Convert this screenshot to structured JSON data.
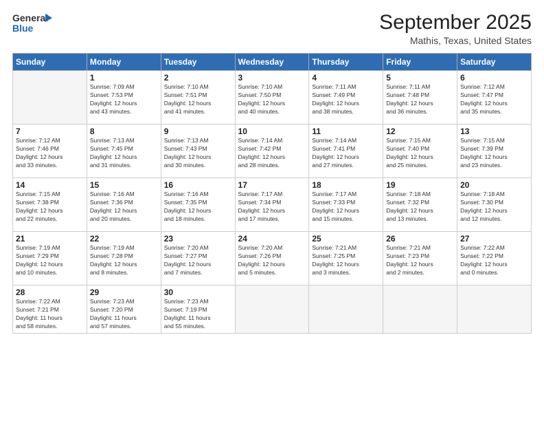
{
  "logo": {
    "line1": "General",
    "line2": "Blue"
  },
  "header": {
    "month": "September 2025",
    "location": "Mathis, Texas, United States"
  },
  "weekdays": [
    "Sunday",
    "Monday",
    "Tuesday",
    "Wednesday",
    "Thursday",
    "Friday",
    "Saturday"
  ],
  "weeks": [
    [
      {
        "day": "",
        "info": ""
      },
      {
        "day": "1",
        "info": "Sunrise: 7:09 AM\nSunset: 7:53 PM\nDaylight: 12 hours\nand 43 minutes."
      },
      {
        "day": "2",
        "info": "Sunrise: 7:10 AM\nSunset: 7:51 PM\nDaylight: 12 hours\nand 41 minutes."
      },
      {
        "day": "3",
        "info": "Sunrise: 7:10 AM\nSunset: 7:50 PM\nDaylight: 12 hours\nand 40 minutes."
      },
      {
        "day": "4",
        "info": "Sunrise: 7:11 AM\nSunset: 7:49 PM\nDaylight: 12 hours\nand 38 minutes."
      },
      {
        "day": "5",
        "info": "Sunrise: 7:11 AM\nSunset: 7:48 PM\nDaylight: 12 hours\nand 36 minutes."
      },
      {
        "day": "6",
        "info": "Sunrise: 7:12 AM\nSunset: 7:47 PM\nDaylight: 12 hours\nand 35 minutes."
      }
    ],
    [
      {
        "day": "7",
        "info": "Sunrise: 7:12 AM\nSunset: 7:46 PM\nDaylight: 12 hours\nand 33 minutes."
      },
      {
        "day": "8",
        "info": "Sunrise: 7:13 AM\nSunset: 7:45 PM\nDaylight: 12 hours\nand 31 minutes."
      },
      {
        "day": "9",
        "info": "Sunrise: 7:13 AM\nSunset: 7:43 PM\nDaylight: 12 hours\nand 30 minutes."
      },
      {
        "day": "10",
        "info": "Sunrise: 7:14 AM\nSunset: 7:42 PM\nDaylight: 12 hours\nand 28 minutes."
      },
      {
        "day": "11",
        "info": "Sunrise: 7:14 AM\nSunset: 7:41 PM\nDaylight: 12 hours\nand 27 minutes."
      },
      {
        "day": "12",
        "info": "Sunrise: 7:15 AM\nSunset: 7:40 PM\nDaylight: 12 hours\nand 25 minutes."
      },
      {
        "day": "13",
        "info": "Sunrise: 7:15 AM\nSunset: 7:39 PM\nDaylight: 12 hours\nand 23 minutes."
      }
    ],
    [
      {
        "day": "14",
        "info": "Sunrise: 7:15 AM\nSunset: 7:38 PM\nDaylight: 12 hours\nand 22 minutes."
      },
      {
        "day": "15",
        "info": "Sunrise: 7:16 AM\nSunset: 7:36 PM\nDaylight: 12 hours\nand 20 minutes."
      },
      {
        "day": "16",
        "info": "Sunrise: 7:16 AM\nSunset: 7:35 PM\nDaylight: 12 hours\nand 18 minutes."
      },
      {
        "day": "17",
        "info": "Sunrise: 7:17 AM\nSunset: 7:34 PM\nDaylight: 12 hours\nand 17 minutes."
      },
      {
        "day": "18",
        "info": "Sunrise: 7:17 AM\nSunset: 7:33 PM\nDaylight: 12 hours\nand 15 minutes."
      },
      {
        "day": "19",
        "info": "Sunrise: 7:18 AM\nSunset: 7:32 PM\nDaylight: 12 hours\nand 13 minutes."
      },
      {
        "day": "20",
        "info": "Sunrise: 7:18 AM\nSunset: 7:30 PM\nDaylight: 12 hours\nand 12 minutes."
      }
    ],
    [
      {
        "day": "21",
        "info": "Sunrise: 7:19 AM\nSunset: 7:29 PM\nDaylight: 12 hours\nand 10 minutes."
      },
      {
        "day": "22",
        "info": "Sunrise: 7:19 AM\nSunset: 7:28 PM\nDaylight: 12 hours\nand 8 minutes."
      },
      {
        "day": "23",
        "info": "Sunrise: 7:20 AM\nSunset: 7:27 PM\nDaylight: 12 hours\nand 7 minutes."
      },
      {
        "day": "24",
        "info": "Sunrise: 7:20 AM\nSunset: 7:26 PM\nDaylight: 12 hours\nand 5 minutes."
      },
      {
        "day": "25",
        "info": "Sunrise: 7:21 AM\nSunset: 7:25 PM\nDaylight: 12 hours\nand 3 minutes."
      },
      {
        "day": "26",
        "info": "Sunrise: 7:21 AM\nSunset: 7:23 PM\nDaylight: 12 hours\nand 2 minutes."
      },
      {
        "day": "27",
        "info": "Sunrise: 7:22 AM\nSunset: 7:22 PM\nDaylight: 12 hours\nand 0 minutes."
      }
    ],
    [
      {
        "day": "28",
        "info": "Sunrise: 7:22 AM\nSunset: 7:21 PM\nDaylight: 11 hours\nand 58 minutes."
      },
      {
        "day": "29",
        "info": "Sunrise: 7:23 AM\nSunset: 7:20 PM\nDaylight: 11 hours\nand 57 minutes."
      },
      {
        "day": "30",
        "info": "Sunrise: 7:23 AM\nSunset: 7:19 PM\nDaylight: 11 hours\nand 55 minutes."
      },
      {
        "day": "",
        "info": ""
      },
      {
        "day": "",
        "info": ""
      },
      {
        "day": "",
        "info": ""
      },
      {
        "day": "",
        "info": ""
      }
    ]
  ]
}
